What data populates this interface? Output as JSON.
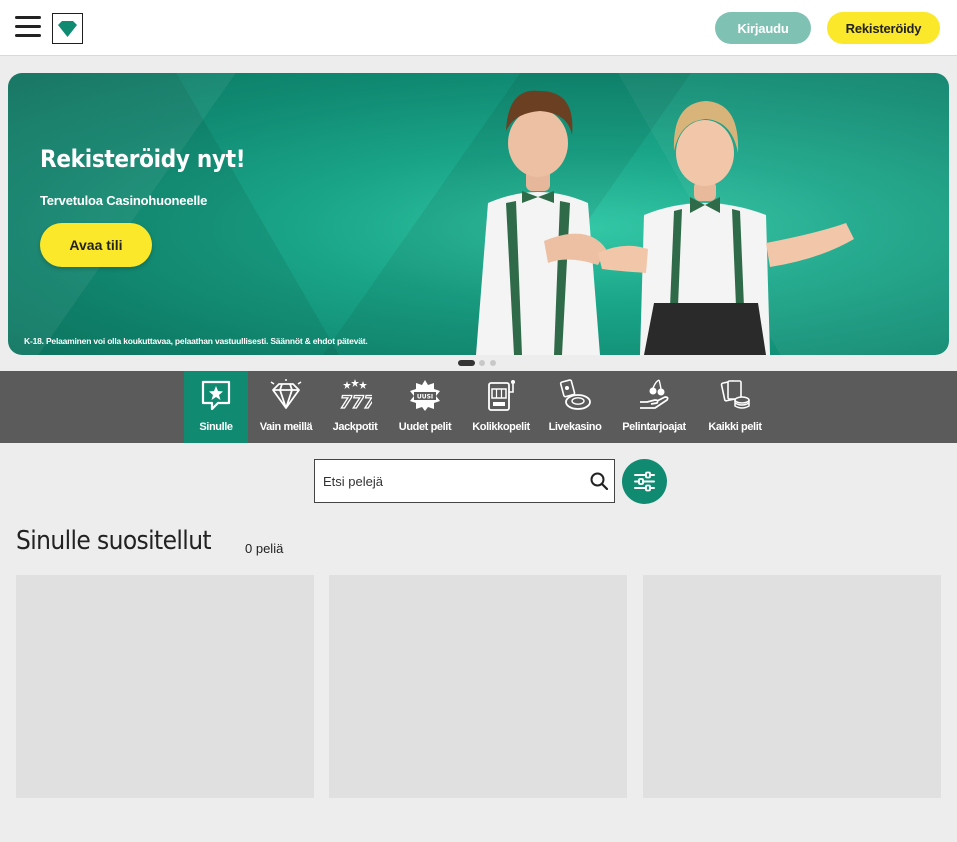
{
  "header": {
    "login_label": "Kirjaudu",
    "register_label": "Rekisteröidy"
  },
  "hero": {
    "title": "Rekisteröidy nyt!",
    "subtitle": "Tervetuloa Casinohuoneelle",
    "cta_label": "Avaa tili",
    "disclaimer": "K-18. Pelaaminen voi olla koukuttavaa, pelaathan vastuullisesti. Säännöt & ehdot pätevät.",
    "slide_count": 3,
    "active_slide": 1
  },
  "categories": [
    {
      "label": "Sinulle",
      "icon": "star-bubble-icon",
      "active": true
    },
    {
      "label": "Vain meillä",
      "icon": "diamond-icon",
      "active": false
    },
    {
      "label": "Jackpotit",
      "icon": "triple-seven-icon",
      "active": false
    },
    {
      "label": "Uudet pelit",
      "icon": "new-badge-icon",
      "active": false
    },
    {
      "label": "Kolikkopelit",
      "icon": "slot-machine-icon",
      "active": false
    },
    {
      "label": "Livekasino",
      "icon": "roulette-icon",
      "active": false
    },
    {
      "label": "Pelintarjoajat",
      "icon": "cherry-hand-icon",
      "active": false
    },
    {
      "label": "Kaikki pelit",
      "icon": "cards-chips-icon",
      "active": false
    }
  ],
  "search": {
    "placeholder": "Etsi pelejä"
  },
  "section": {
    "title": "Sinulle suositellut",
    "count": "0 peliä"
  },
  "colors": {
    "brand_green": "#118a72",
    "accent_yellow": "#fce82a",
    "login_teal": "#7fc2b3",
    "category_bar": "#5b5b5b"
  }
}
